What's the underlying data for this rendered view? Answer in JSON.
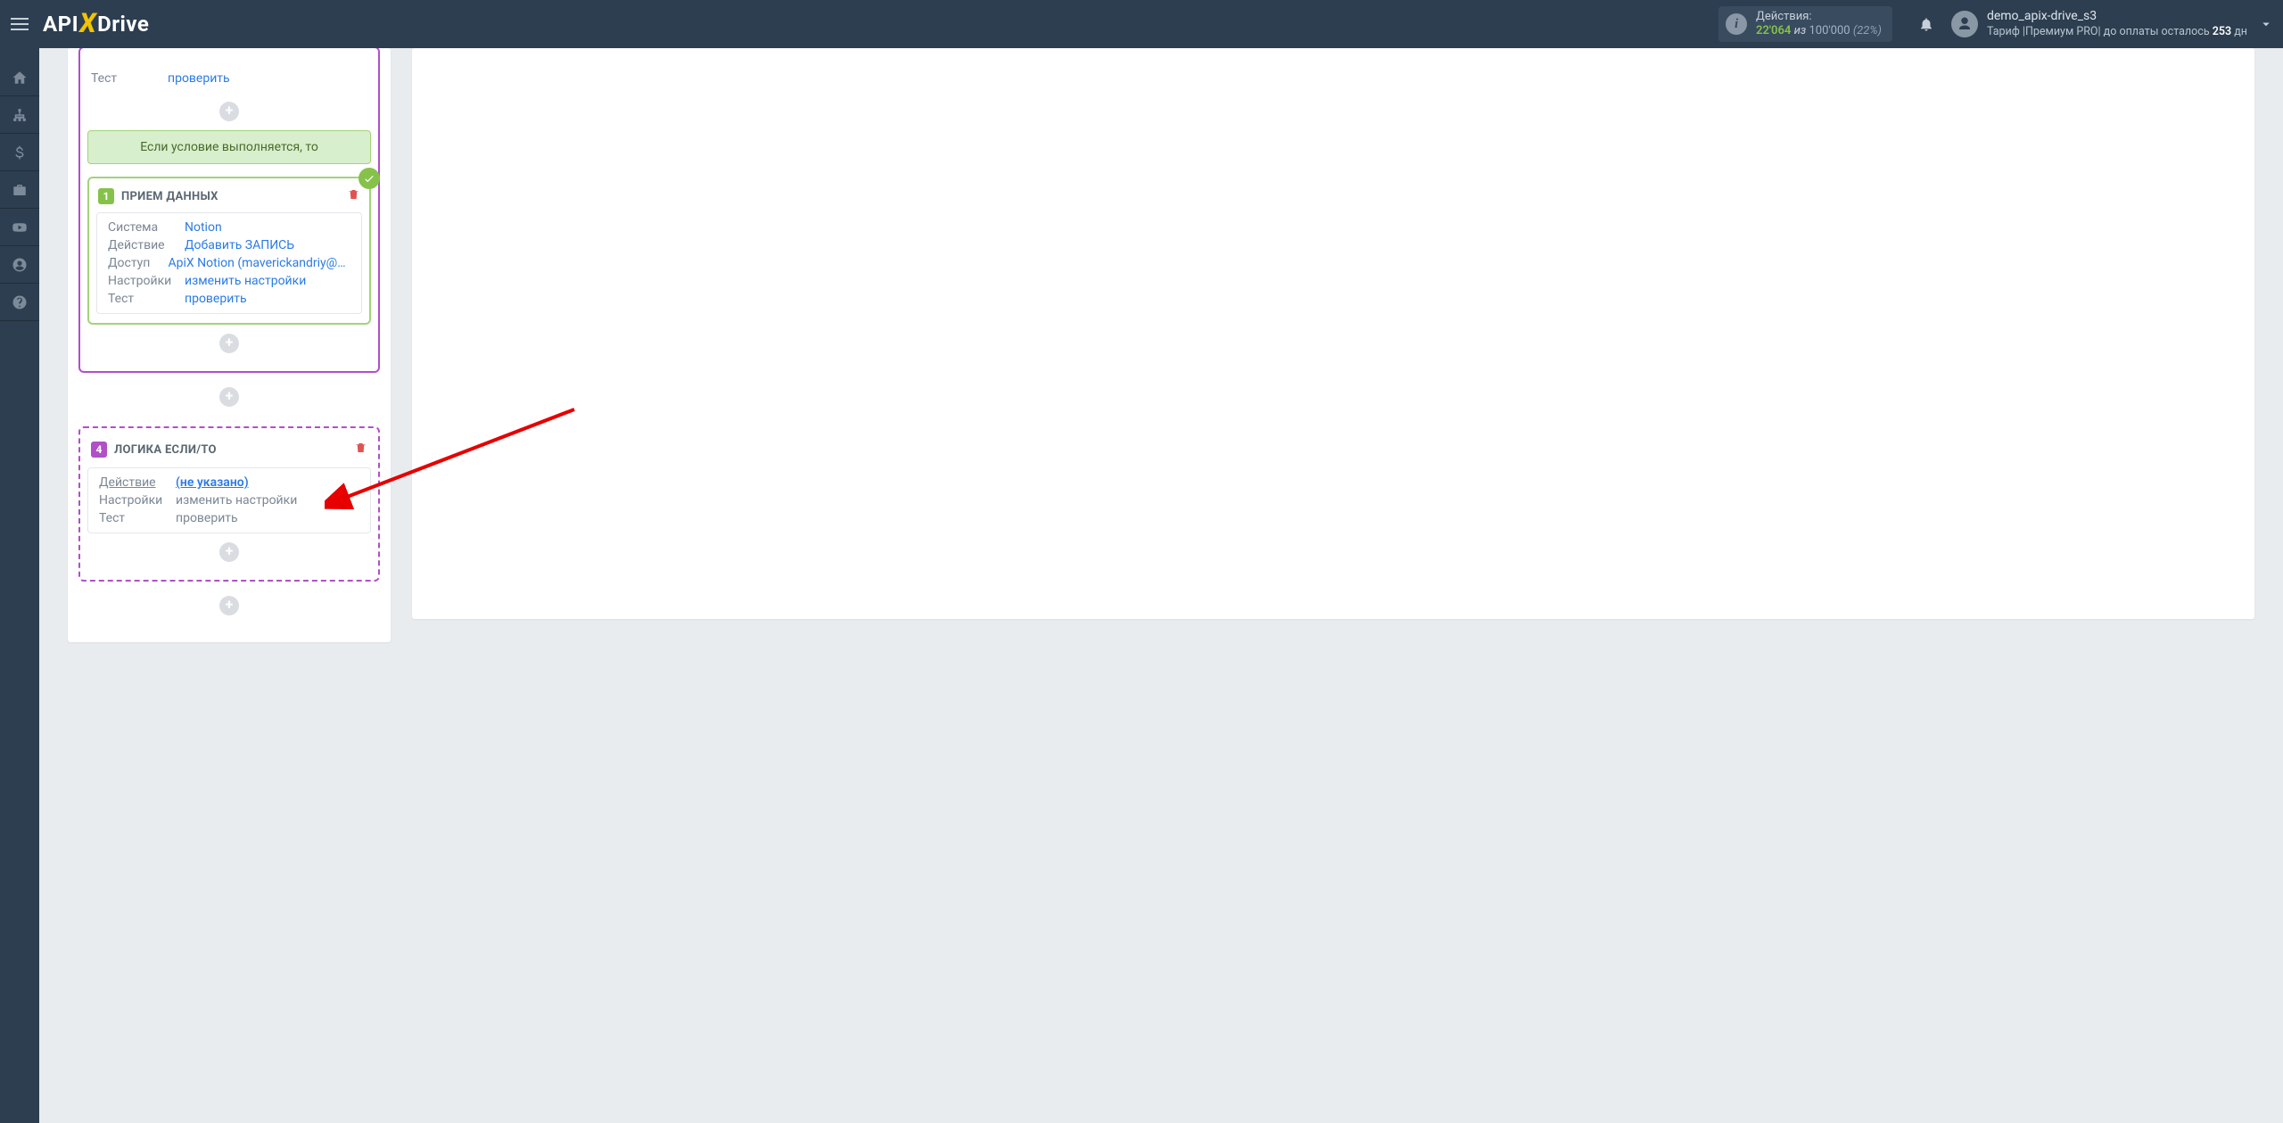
{
  "header": {
    "logo_api": "API",
    "logo_drive": "Drive",
    "stats_label": "Действия:",
    "stats_used": "22'064",
    "stats_iz": "из",
    "stats_max": "100'000",
    "stats_pct": "(22%)",
    "user_name": "demo_apix-drive_s3",
    "user_plan_prefix": "Тариф |",
    "user_plan_name": "Премиум PRO",
    "user_plan_mid": "| до оплаты осталось ",
    "user_plan_days": "253",
    "user_plan_suffix": " дн"
  },
  "block0": {
    "r1_label": "Тест",
    "r1_value": "проверить"
  },
  "condition_banner": "Если условие выполняется, то",
  "block1": {
    "num": "1",
    "title": "ПРИЕМ ДАННЫХ",
    "r1_label": "Система",
    "r1_value": "Notion",
    "r2_label": "Действие",
    "r2_value": "Добавить ЗАПИСЬ",
    "r3_label": "Доступ",
    "r3_value": "ApiX Notion (maverickandriy@gmail.com)",
    "r4_label": "Настройки",
    "r4_value": "изменить настройки",
    "r5_label": "Тест",
    "r5_value": "проверить"
  },
  "block4": {
    "num": "4",
    "title": "ЛОГИКА ЕСЛИ/ТО",
    "r1_label": "Действие",
    "r1_value": "(не указано)",
    "r2_label": "Настройки",
    "r2_value": "изменить настройки",
    "r3_label": "Тест",
    "r3_value": "проверить"
  },
  "plus": "+"
}
